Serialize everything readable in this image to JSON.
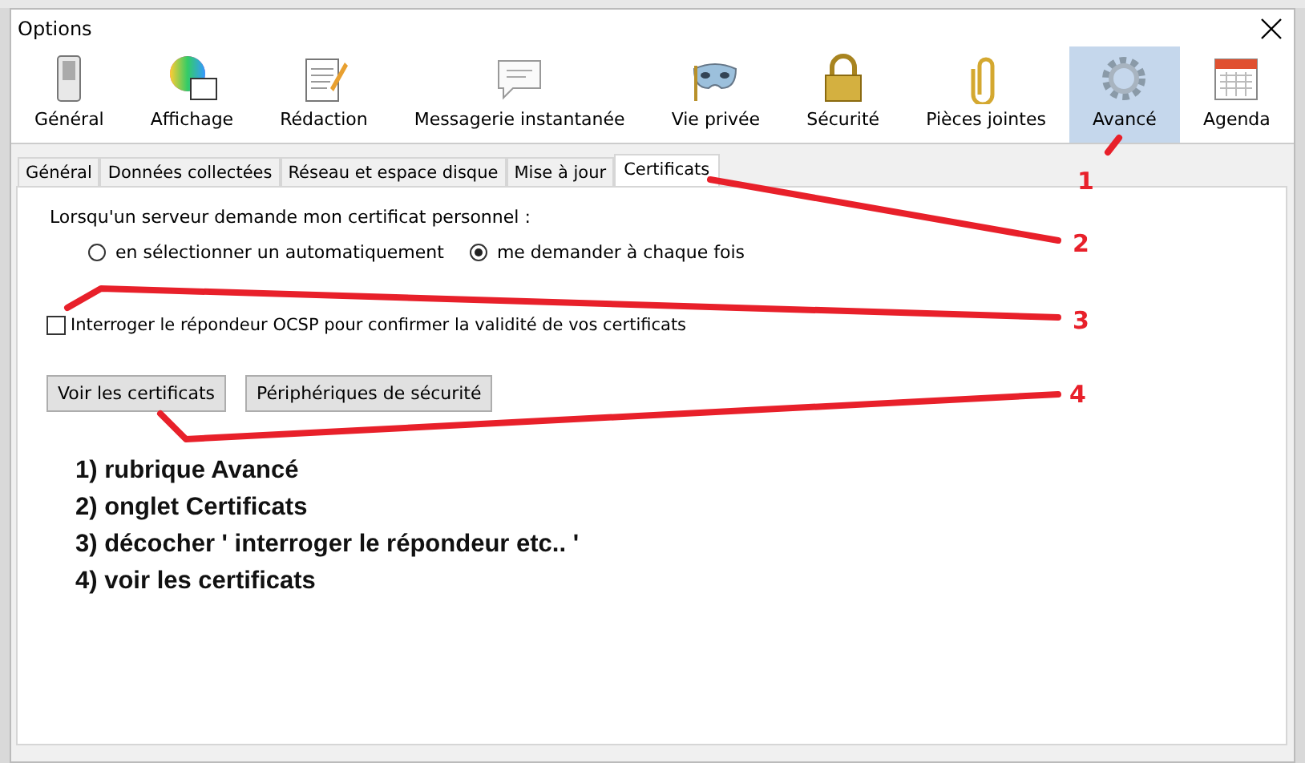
{
  "window": {
    "title": "Options"
  },
  "toolbar": [
    {
      "label": "Général",
      "kind": "switch",
      "selected": false
    },
    {
      "label": "Affichage",
      "kind": "palette",
      "selected": false
    },
    {
      "label": "Rédaction",
      "kind": "compose",
      "selected": false
    },
    {
      "label": "Messagerie instantanée",
      "kind": "chat",
      "selected": false
    },
    {
      "label": "Vie privée",
      "kind": "mask",
      "selected": false
    },
    {
      "label": "Sécurité",
      "kind": "lock",
      "selected": false
    },
    {
      "label": "Pièces jointes",
      "kind": "clip",
      "selected": false
    },
    {
      "label": "Avancé",
      "kind": "gear",
      "selected": true
    },
    {
      "label": "Agenda",
      "kind": "calendar",
      "selected": false
    }
  ],
  "tabs": [
    {
      "label": "Général",
      "selected": false
    },
    {
      "label": "Données collectées",
      "selected": false
    },
    {
      "label": "Réseau et espace disque",
      "selected": false
    },
    {
      "label": "Mise à jour",
      "selected": false
    },
    {
      "label": "Certificats",
      "selected": true
    }
  ],
  "panel": {
    "prompt": "Lorsqu'un serveur demande mon certificat personnel :",
    "radios": [
      {
        "label": "en sélectionner un automatiquement",
        "selected": false
      },
      {
        "label": "me demander à chaque fois",
        "selected": true
      }
    ],
    "checkbox": {
      "label": "Interroger le répondeur OCSP pour confirmer la validité de vos certificats",
      "checked": false
    },
    "buttons": [
      "Voir les certificats",
      "Périphériques de sécurité"
    ],
    "instructions": [
      "1) rubrique Avancé",
      "2) onglet Certificats",
      "3) décocher ' interroger le répondeur etc.. '",
      "4) voir les certificats"
    ]
  },
  "annotations": [
    "1",
    "2",
    "3",
    "4"
  ]
}
